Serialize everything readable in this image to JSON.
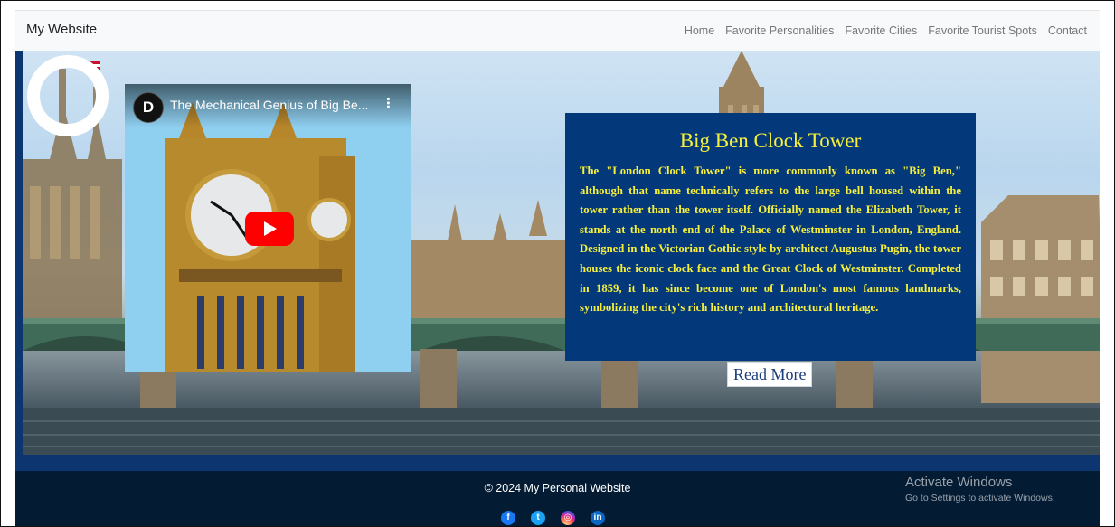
{
  "navbar": {
    "brand": "My Website",
    "links": [
      "Home",
      "Favorite Personalities",
      "Favorite Cities",
      "Favorite Tourist Spots",
      "Contact"
    ]
  },
  "video": {
    "channel_icon": "discovery-logo-icon",
    "title": "The Mechanical Genius of Big Be...",
    "menu_icon": "more-vert-icon",
    "play_icon": "youtube-play-icon"
  },
  "info": {
    "title": "Big Ben Clock Tower",
    "text": "The \"London Clock Tower\" is more commonly known as \"Big Ben,\" although that name technically refers to the large bell housed within the tower rather than the tower itself. Officially named the Elizabeth Tower, it stands at the north end of the Palace of Westminster in London, England. Designed in the Victorian Gothic style by architect Augustus Pugin, the tower houses the iconic clock face and the Great Clock of Westminster. Completed in 1859, it has since become one of London's most famous landmarks, symbolizing the city's rich history and architectural heritage.",
    "button": "Read More"
  },
  "footer": {
    "copyright": "© 2024 My Personal Website",
    "social": [
      {
        "icon": "facebook-icon",
        "glyph": "f"
      },
      {
        "icon": "twitter-icon",
        "glyph": "t"
      },
      {
        "icon": "instagram-icon",
        "glyph": "◎"
      },
      {
        "icon": "linkedin-icon",
        "glyph": "in"
      }
    ]
  },
  "watermark": {
    "line1": "Activate Windows",
    "line2": "Go to Settings to activate Windows."
  },
  "colors": {
    "accent_yellow": "#f6ef3c",
    "info_bg": "#03387a",
    "footer_bg": "#031b33",
    "navbar_bg": "#f8f9fa"
  }
}
